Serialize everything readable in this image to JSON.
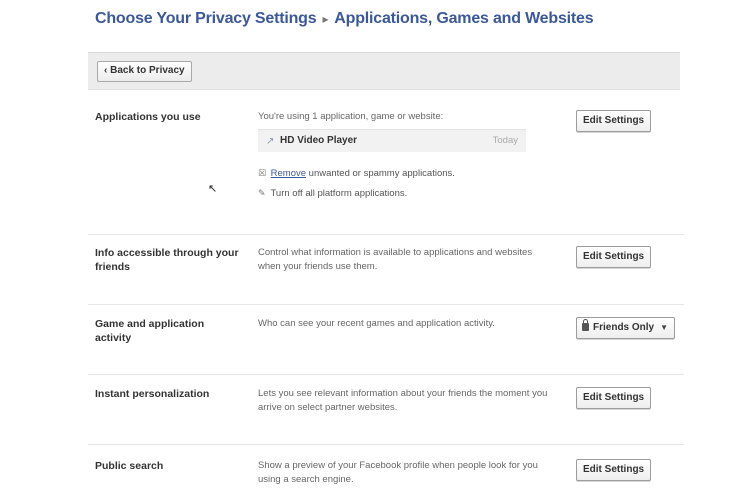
{
  "title": {
    "main": "Choose Your Privacy Settings",
    "separator": "▸",
    "section": "Applications, Games and Websites"
  },
  "toolbar": {
    "back_label": "‹ Back to Privacy"
  },
  "rows": [
    {
      "label": "Applications you use",
      "description": "You're using 1 application, game or website:",
      "button": "Edit Settings",
      "app": {
        "name": "HD Video Player",
        "date": "Today"
      },
      "actions": [
        {
          "link": "Remove",
          "text": " unwanted or spammy applications."
        },
        {
          "link": "Turn off",
          "text": " all platform applications."
        }
      ]
    },
    {
      "label": "Info accessible through your friends",
      "description": "Control what information is available to applications and websites when your friends use them.",
      "button": "Edit Settings"
    },
    {
      "label": "Game and application activity",
      "description": "Who can see your recent games and application activity.",
      "button": "Friends Only"
    },
    {
      "label": "Instant personalization",
      "description": "Lets you see relevant information about your friends the moment you arrive on select partner websites.",
      "button": "Edit Settings"
    },
    {
      "label": "Public search",
      "description": "Show a preview of your Facebook profile when people look for you using a search engine.",
      "button": "Edit Settings"
    }
  ],
  "icons": {
    "app_icon": "link-icon",
    "remove_icon": "close-box-icon",
    "turn_off_icon": "pencil-icon",
    "lock_icon": "lock-icon",
    "dropdown_icon": "chevron-down-icon"
  },
  "colors": {
    "title": "#3b5998",
    "link": "#3b5998",
    "toolbar_bg": "#ececec"
  }
}
